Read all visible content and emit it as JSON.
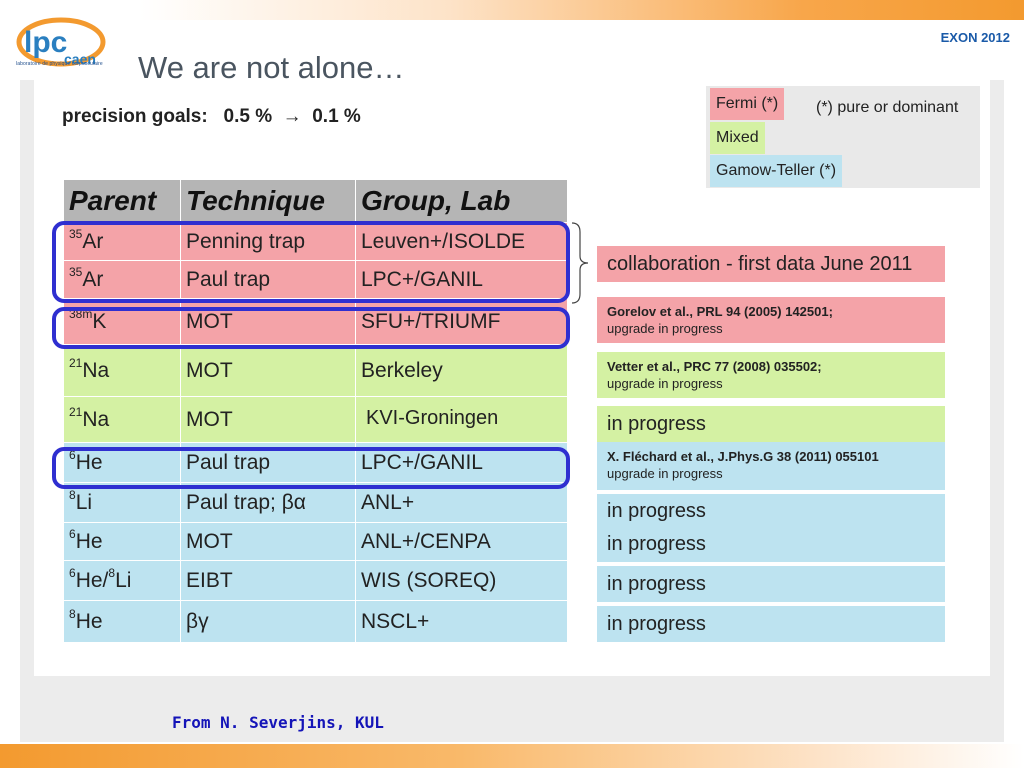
{
  "header": {
    "logo_text": "lpc caen",
    "logo_subtitle": "laboratoire de physique corpusculaire",
    "conference": "EXON 2012",
    "title": "We are not alone…"
  },
  "precision": "precision goals:   0.5 %  →  0.1 %",
  "legend": {
    "fermi": "Fermi (*)",
    "mixed": "Mixed",
    "gamow_teller": "Gamow-Teller (*)",
    "note": "(*) pure or dominant"
  },
  "colors": {
    "fermi": "#f4a3a8",
    "mixed": "#d4f1a3",
    "gamow_teller": "#bde3f0",
    "highlight": "#2f2fd0",
    "accent": "#f39a2f"
  },
  "table": {
    "headers": [
      "Parent",
      "Technique",
      "Group, Lab"
    ],
    "rows": [
      {
        "mass": "35",
        "element": "Ar",
        "technique": "Penning trap",
        "lab": "Leuven+/ISOLDE",
        "type": "fermi"
      },
      {
        "mass": "35",
        "element": "Ar",
        "technique": "Paul trap",
        "lab": "LPC+/GANIL",
        "type": "fermi"
      },
      {
        "mass": "38m",
        "element": "K",
        "technique": "MOT",
        "lab": "SFU+/TRIUMF",
        "type": "fermi"
      },
      {
        "mass": "21",
        "element": "Na",
        "technique": "MOT",
        "lab": "Berkeley",
        "type": "mixed"
      },
      {
        "mass": "21",
        "element": "Na",
        "technique": "MOT",
        "lab": "",
        "type": "mixed"
      },
      {
        "mass": "6",
        "element": "He",
        "technique": "Paul trap",
        "lab": "LPC+/GANIL",
        "type": "gt"
      },
      {
        "mass": "8",
        "element": "Li",
        "technique": "Paul trap; βα",
        "lab": "ANL+",
        "type": "gt"
      },
      {
        "mass": "6",
        "element": "He",
        "technique": "MOT",
        "lab": "ANL+/CENPA",
        "type": "gt"
      },
      {
        "mass": "6",
        "element": "He/",
        "mass2": "8",
        "element2": "Li",
        "technique": "EIBT",
        "lab": "WIS (SOREQ)",
        "type": "gt"
      },
      {
        "mass": "8",
        "element": "He",
        "technique": "βγ",
        "lab": "NSCL+",
        "type": "gt"
      }
    ],
    "kvi_label": "KVI-Groningen"
  },
  "status": {
    "collab": "collaboration  -  first data June 2011",
    "gorelov_ref": "Gorelov et al., PRL 94 (2005) 142501;",
    "gorelov_sub": "upgrade in progress",
    "vetter_ref": "Vetter et al., PRC 77 (2008) 035502;",
    "vetter_sub": "upgrade in progress",
    "na_progress": "in progress",
    "flechard_ref": "X. Fléchard et al., J.Phys.G 38 (2011) 055101",
    "flechard_sub": "upgrade in progress",
    "li8_progress": "in progress",
    "he6_mot_progress": "in progress",
    "eibt_progress": "in progress",
    "he8_progress": "in progress"
  },
  "credit": "From N. Severjins, KUL"
}
